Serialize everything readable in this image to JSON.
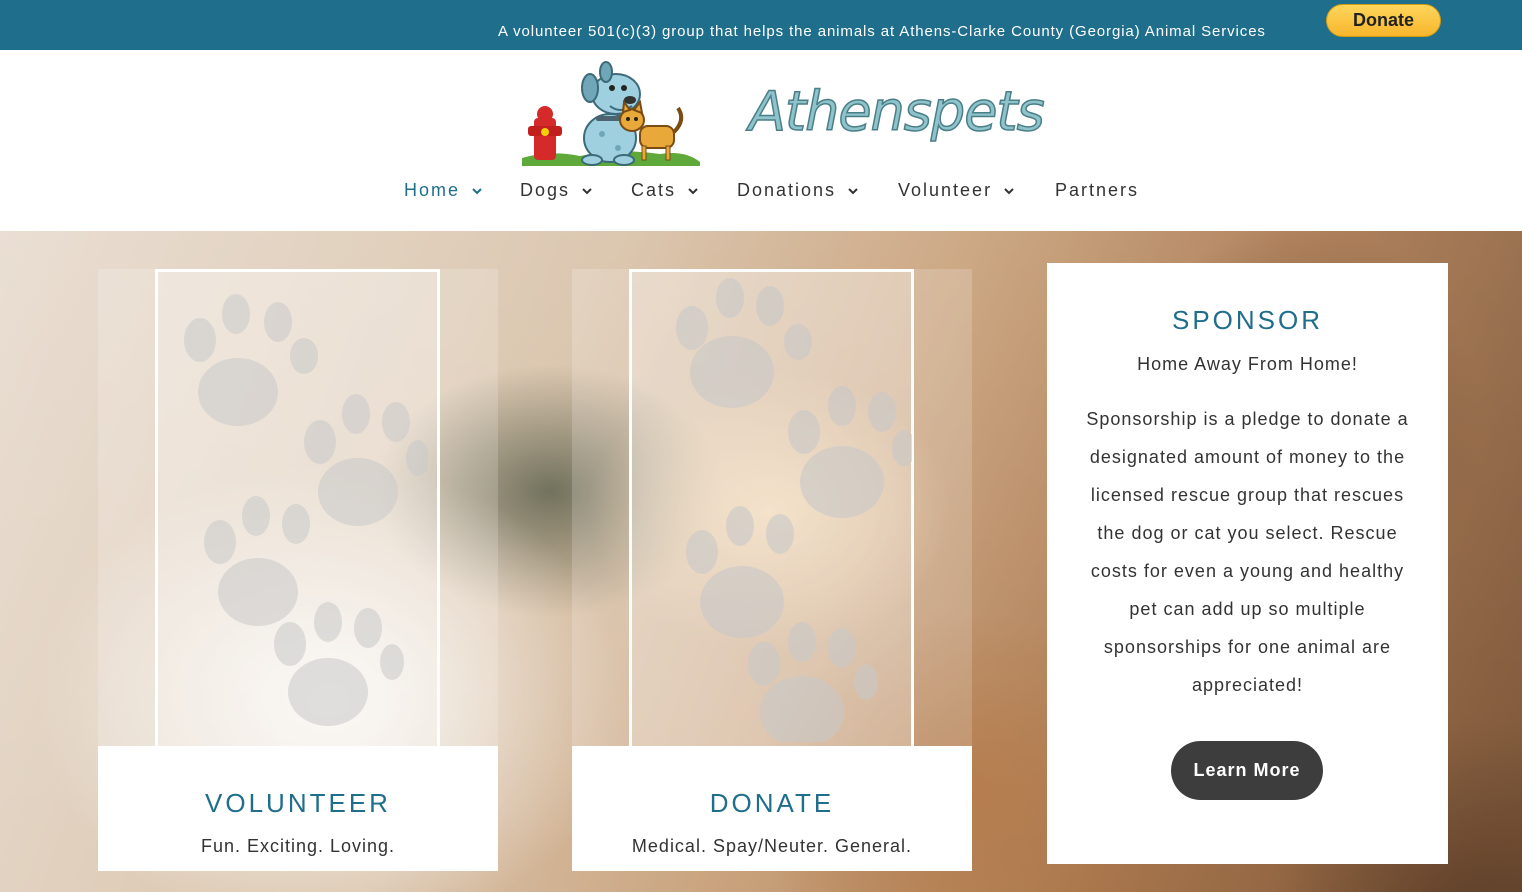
{
  "topbar": {
    "tagline": "A volunteer 501(c)(3) group that helps the animals at Athens-Clarke County (Georgia) Animal Services",
    "donate_label": "Donate",
    "bg_color": "#1f6e8c"
  },
  "header": {
    "logo_text": "Athenspets",
    "nav": [
      {
        "label": "Home",
        "has_dropdown": true,
        "active": true
      },
      {
        "label": "Dogs",
        "has_dropdown": true,
        "active": false
      },
      {
        "label": "Cats",
        "has_dropdown": true,
        "active": false
      },
      {
        "label": "Donations",
        "has_dropdown": true,
        "active": false
      },
      {
        "label": "Volunteer",
        "has_dropdown": true,
        "active": false
      },
      {
        "label": "Partners",
        "has_dropdown": false,
        "active": false
      }
    ]
  },
  "cards": {
    "volunteer": {
      "title": "VOLUNTEER",
      "subtitle": "Fun. Exciting. Loving."
    },
    "donate": {
      "title": "DONATE",
      "subtitle": "Medical. Spay/Neuter. General."
    },
    "sponsor": {
      "title": "SPONSOR",
      "subtitle": "Home Away From Home!",
      "body": "Sponsorship is a pledge to donate a designated amount of money to the licensed rescue group that rescues the dog or cat you select. Rescue costs for even a young and healthy pet can add up so multiple sponsorships for one animal are appreciated!",
      "button_label": "Learn More"
    }
  },
  "colors": {
    "accent": "#1f6e8c",
    "button_dark": "#3d3d3d",
    "donate_yellow": "#ffc439"
  }
}
